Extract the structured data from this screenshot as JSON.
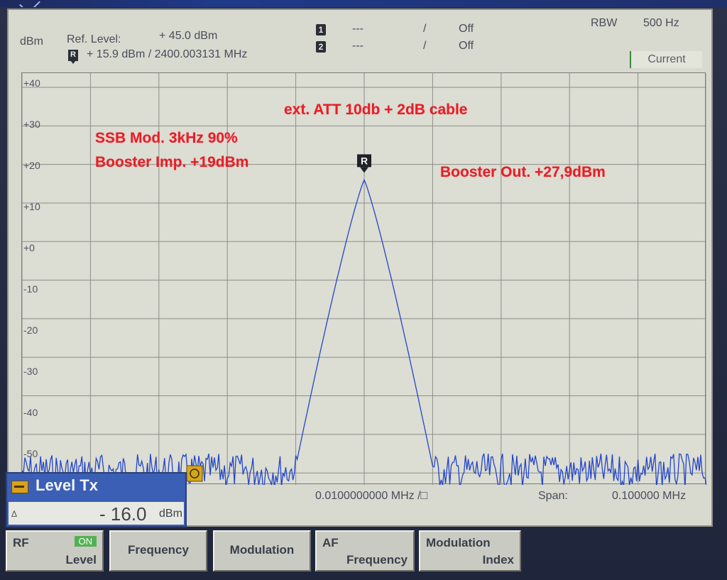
{
  "header": {
    "unit": "dBm",
    "ref_level_label": "Ref. Level:",
    "ref_level_value": "+ 45.0  dBm",
    "marker_readout": "+ 15.9  dBm /  2400.003131   MHz",
    "m1_value": "---",
    "m1_sep": "/",
    "m1_state": "Off",
    "m2_value": "---",
    "m2_sep": "/",
    "m2_state": "Off",
    "rbw_label": "RBW",
    "rbw_value": "500 Hz",
    "trace_mode": "Current",
    "marker1_badge": "1",
    "marker2_badge": "2",
    "ref_badge": "R"
  },
  "y_axis": {
    "labels": [
      "+40",
      "+30",
      "+20",
      "+10",
      "+0",
      "-10",
      "-20",
      "-30",
      "-40",
      "-50"
    ]
  },
  "annotations": {
    "att": "ext. ATT 10db + 2dB cable",
    "mod": "SSB Mod. 3kHz 90%",
    "booster_in": "Booster Imp. +19dBm",
    "booster_out": "Booster Out. +27,9dBm"
  },
  "chart_data": {
    "type": "line",
    "ylabel": "dBm",
    "ylim": [
      -60,
      40
    ],
    "xlim": [
      -0.05,
      0.05
    ],
    "peak": {
      "x": 0.0,
      "y": 16
    },
    "center_freq_text": "0.0100000000 MHz  /□",
    "span_label": "Span:",
    "span_value": "0.100000  MHz",
    "trace_color": "#2346c8",
    "noise_floor": -53
  },
  "level_panel": {
    "title": "Level Tx",
    "delta": "Δ",
    "value": "- 16.0",
    "unit": "dBm"
  },
  "softkeys": {
    "rf": "RF",
    "rf_on": "ON",
    "rf_level": "Level",
    "frequency": "Frequency",
    "modulation": "Modulation",
    "af": "AF",
    "af_frequency": "Frequency",
    "mod_index_1": "Modulation",
    "mod_index_2": "Index"
  }
}
